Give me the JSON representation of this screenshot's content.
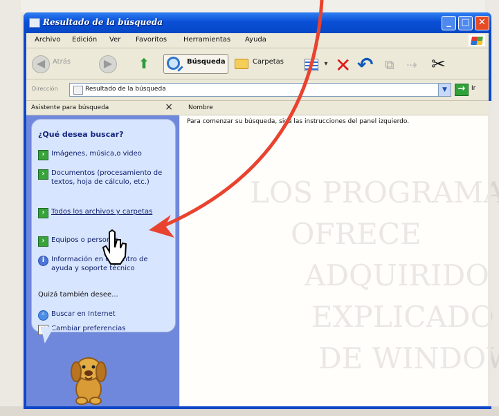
{
  "window": {
    "title": "Resultado de la búsqueda",
    "title_buttons": [
      "_",
      "□",
      "✕"
    ]
  },
  "menubar": {
    "items": [
      "Archivo",
      "Edición",
      "Ver",
      "Favoritos",
      "Herramientas",
      "Ayuda"
    ]
  },
  "toolbar": {
    "back_label": "Atrás",
    "search_label": "Búsqueda",
    "folders_label": "Carpetas",
    "icons": [
      "back-icon",
      "forward-icon",
      "up-icon",
      "search-icon",
      "folder-icon",
      "views-icon",
      "delete-icon",
      "undo-icon",
      "copy-icon",
      "move-icon",
      "cut-icon"
    ]
  },
  "addressbar": {
    "label": "Dirección",
    "value": "Resultado de la búsqueda",
    "go_label": "Ir"
  },
  "side_panel": {
    "header": "Asistente para búsqueda",
    "close_label": "×",
    "question": "¿Qué desea buscar?",
    "options": [
      "Imágenes, música,o video",
      "Documentos (procesamiento de textos, hoja de cálculo, etc.)",
      "Todos los archivos y carpetas",
      "Equipos o personas",
      "Información en el Centro de ayuda y soporte técnico"
    ],
    "also_title": "Quizá también desee...",
    "also_items": [
      "Buscar en Internet",
      "Cambiar preferencias"
    ]
  },
  "results": {
    "column_header": "Nombre",
    "instruction": "Para comenzar su búsqueda, siga las instrucciones del panel izquierdo.",
    "watermark_lines": [
      "LOS PROGRAMAS",
      "OFRECE",
      "ADQUIRIDO",
      "EXPLICADO",
      "DE WINDOWS"
    ]
  },
  "colors": {
    "title_blue": "#0a4fd6",
    "panel_blue": "#6f88db",
    "red_arrow": "#e9432f",
    "green_icon": "#38a33b"
  }
}
